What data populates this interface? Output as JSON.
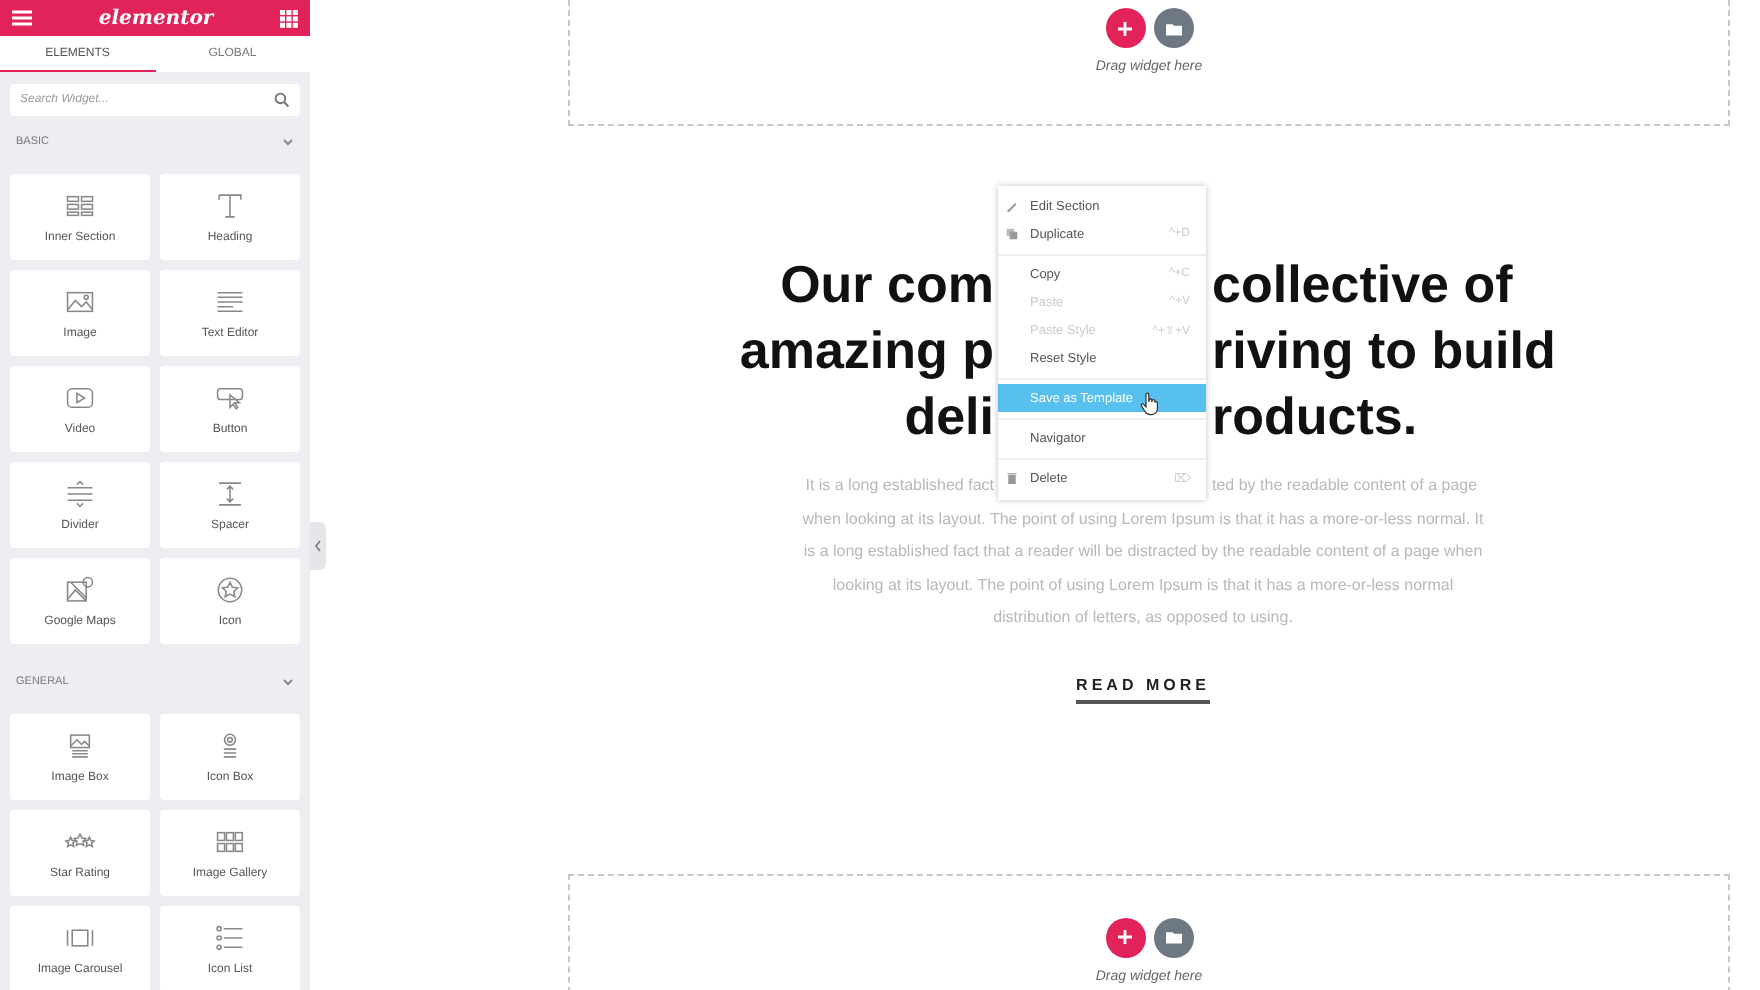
{
  "sidebar": {
    "logo": "elementor",
    "tabs": [
      {
        "label": "ELEMENTS",
        "selected": true
      },
      {
        "label": "GLOBAL",
        "selected": false
      }
    ],
    "search": {
      "placeholder": "Search Widget..."
    },
    "categories": [
      {
        "title": "BASIC",
        "expanded": true,
        "widgets": [
          {
            "label": "Inner Section"
          },
          {
            "label": "Heading"
          },
          {
            "label": "Image"
          },
          {
            "label": "Text Editor"
          },
          {
            "label": "Video"
          },
          {
            "label": "Button"
          },
          {
            "label": "Divider"
          },
          {
            "label": "Spacer"
          },
          {
            "label": "Google Maps"
          },
          {
            "label": "Icon"
          }
        ]
      },
      {
        "title": "GENERAL",
        "expanded": true,
        "widgets": [
          {
            "label": "Image Box"
          },
          {
            "label": "Icon Box"
          },
          {
            "label": "Star Rating"
          },
          {
            "label": "Image Gallery"
          },
          {
            "label": "Image Carousel"
          },
          {
            "label": "Icon List"
          }
        ]
      }
    ]
  },
  "canvas": {
    "top_dropzone": {
      "hint": "Drag widget here"
    },
    "heading_lines": [
      {
        "left": "Our com",
        "right": "collective of"
      },
      {
        "left": "amazing p",
        "right": "riving to build"
      },
      {
        "left": "deli",
        "right": "roducts."
      }
    ],
    "paragraph_lines": [
      {
        "left": "It is a long established fact",
        "right": "ted by the readable content of a page"
      },
      {
        "text": "when looking at its layout. The point of using Lorem Ipsum is that it has a more-or-less normal. It"
      },
      {
        "text": "is a long established fact that a reader will be distracted by the readable content of a page when"
      },
      {
        "text": "looking at its layout. The point of using Lorem Ipsum is that it has a more-or-less normal"
      },
      {
        "text": "distribution of letters, as opposed to using."
      }
    ],
    "read_more": "READ MORE",
    "bottom_dropzone": {
      "hint": "Drag widget here"
    }
  },
  "context_menu": {
    "items": [
      {
        "kind": "item",
        "label": "Edit Section",
        "disabled": false,
        "selected": false
      },
      {
        "kind": "item",
        "label": "Duplicate",
        "shortcut": "^+D",
        "disabled": false,
        "selected": false
      },
      {
        "kind": "divider"
      },
      {
        "kind": "item",
        "label": "Copy",
        "shortcut": "^+C",
        "disabled": false,
        "selected": false
      },
      {
        "kind": "item",
        "label": "Paste",
        "shortcut": "^+V",
        "disabled": true,
        "selected": false
      },
      {
        "kind": "item",
        "label": "Paste Style",
        "shortcut": "^+⇧+V",
        "disabled": true,
        "selected": false
      },
      {
        "kind": "item",
        "label": "Reset Style",
        "disabled": false,
        "selected": false
      },
      {
        "kind": "divider"
      },
      {
        "kind": "item",
        "label": "Save as Template",
        "disabled": false,
        "selected": true
      },
      {
        "kind": "divider"
      },
      {
        "kind": "item",
        "label": "Navigator",
        "disabled": false,
        "selected": false
      },
      {
        "kind": "divider"
      },
      {
        "kind": "item",
        "label": "Delete",
        "shortcut": "⌦",
        "disabled": false,
        "selected": false
      }
    ]
  }
}
